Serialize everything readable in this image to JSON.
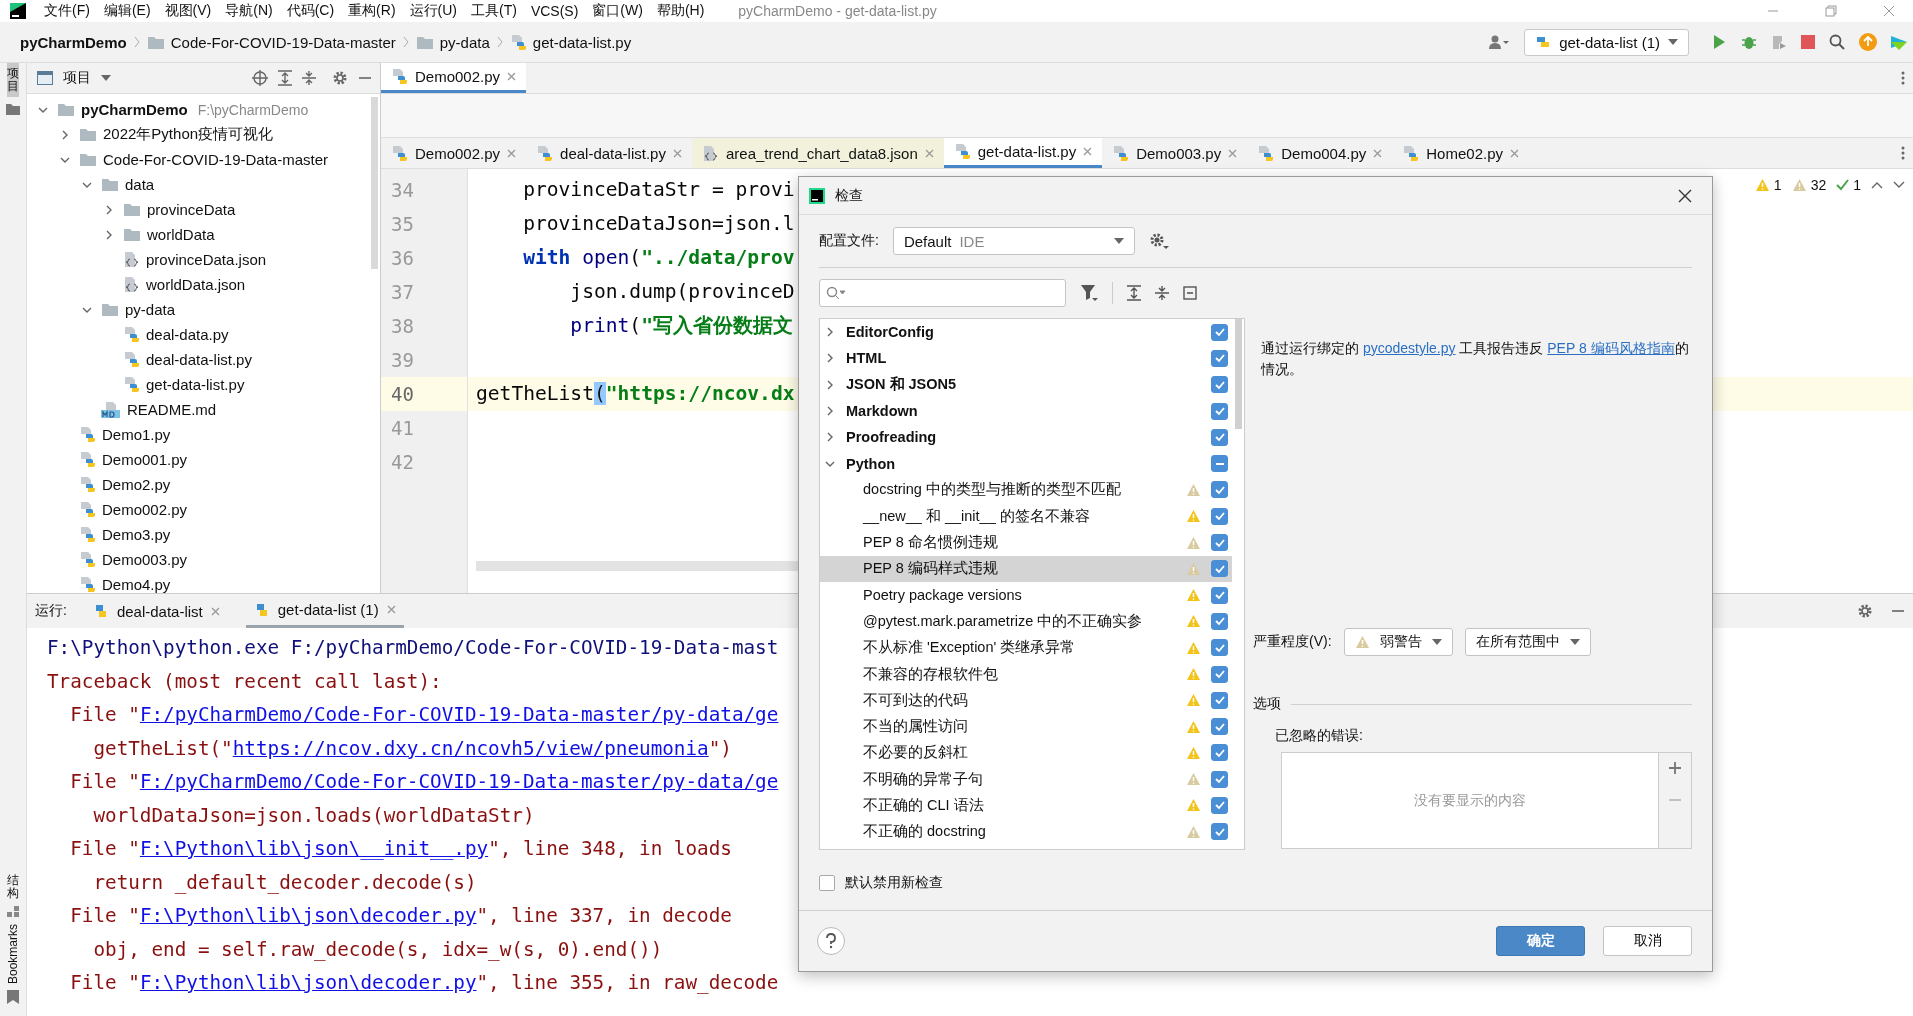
{
  "menu_bar": {
    "items": [
      "文件(F)",
      "编辑(E)",
      "视图(V)",
      "导航(N)",
      "代码(C)",
      "重构(R)",
      "运行(U)",
      "工具(T)",
      "VCS(S)",
      "窗口(W)",
      "帮助(H)"
    ],
    "title": "pyCharmDemo - get-data-list.py"
  },
  "breadcrumb": [
    {
      "label": "pyCharmDemo",
      "kind": "project"
    },
    {
      "label": "Code-For-COVID-19-Data-master",
      "kind": "folder"
    },
    {
      "label": "py-data",
      "kind": "folder"
    },
    {
      "label": "get-data-list.py",
      "kind": "python"
    }
  ],
  "run_config": {
    "label": "get-data-list (1)"
  },
  "tool_stripe": {
    "top": {
      "label": "项目",
      "selected": true
    },
    "bottom": [
      {
        "label": "结构",
        "kind": "cjk"
      },
      {
        "label": "Bookmarks",
        "kind": "latin"
      }
    ]
  },
  "project_panel": {
    "title": "项目",
    "tree": [
      {
        "name": "pyCharmDemo",
        "path": "F:\\pyCharmDemo",
        "kind": "folder",
        "expanded": true,
        "children": [
          {
            "name": "2022年Python疫情可视化",
            "kind": "folder",
            "expanded": false
          },
          {
            "name": "Code-For-COVID-19-Data-master",
            "kind": "folder",
            "expanded": true,
            "children": [
              {
                "name": "data",
                "kind": "folder",
                "expanded": true,
                "children": [
                  {
                    "name": "provinceData",
                    "kind": "folder",
                    "expanded": false
                  },
                  {
                    "name": "worldData",
                    "kind": "folder",
                    "expanded": false
                  },
                  {
                    "name": "provinceData.json",
                    "kind": "json"
                  },
                  {
                    "name": "worldData.json",
                    "kind": "json"
                  }
                ]
              },
              {
                "name": "py-data",
                "kind": "folder",
                "expanded": true,
                "children": [
                  {
                    "name": "deal-data.py",
                    "kind": "python"
                  },
                  {
                    "name": "deal-data-list.py",
                    "kind": "python"
                  },
                  {
                    "name": "get-data-list.py",
                    "kind": "python"
                  }
                ]
              },
              {
                "name": "README.md",
                "kind": "md"
              }
            ]
          },
          {
            "name": "Demo1.py",
            "kind": "python"
          },
          {
            "name": "Demo001.py",
            "kind": "python"
          },
          {
            "name": "Demo2.py",
            "kind": "python"
          },
          {
            "name": "Demo002.py",
            "kind": "python"
          },
          {
            "name": "Demo3.py",
            "kind": "python"
          },
          {
            "name": "Demo003.py",
            "kind": "python"
          },
          {
            "name": "Demo4.py",
            "kind": "python"
          }
        ]
      }
    ]
  },
  "editor": {
    "top_tab": {
      "label": "Demo002.py",
      "kind": "python"
    },
    "tabs": [
      {
        "label": "Demo002.py",
        "kind": "python",
        "selected": false
      },
      {
        "label": "deal-data-list.py",
        "kind": "python",
        "selected": false
      },
      {
        "label": "area_trend_chart_data8.json",
        "kind": "json",
        "selected": false
      },
      {
        "label": "get-data-list.py",
        "kind": "python",
        "selected": true
      },
      {
        "label": "Demo003.py",
        "kind": "python",
        "selected": false
      },
      {
        "label": "Demo004.py",
        "kind": "python",
        "selected": false
      },
      {
        "label": "Home02.py",
        "kind": "python",
        "selected": false
      }
    ],
    "inspection_counts": [
      {
        "kind": "warning",
        "count": "1"
      },
      {
        "kind": "weak_warning",
        "count": "32"
      },
      {
        "kind": "ok",
        "count": "1"
      }
    ],
    "lines": [
      {
        "number": "34",
        "current": false,
        "segments": [
          {
            "kind": "plain",
            "text": "    provinceDataStr = provi"
          }
        ]
      },
      {
        "number": "35",
        "current": false,
        "segments": [
          {
            "kind": "plain",
            "text": "    provinceDataJson=json.l"
          }
        ]
      },
      {
        "number": "36",
        "current": false,
        "segments": [
          {
            "kind": "keyword",
            "text": "    with"
          },
          {
            "kind": "builtin",
            "text": " open"
          },
          {
            "kind": "plain",
            "text": "("
          },
          {
            "kind": "string",
            "text": "\"../data/prov"
          }
        ]
      },
      {
        "number": "37",
        "current": false,
        "segments": [
          {
            "kind": "plain",
            "text": "        json.dump(provinceD"
          }
        ]
      },
      {
        "number": "38",
        "current": false,
        "segments": [
          {
            "kind": "builtin",
            "text": "        print"
          },
          {
            "kind": "plain",
            "text": "("
          },
          {
            "kind": "string",
            "text": "\"写入省份数据文"
          }
        ]
      },
      {
        "number": "39",
        "current": false
      },
      {
        "number": "40",
        "current": true,
        "segments": [
          {
            "kind": "plain",
            "text": "getTheList"
          },
          {
            "kind": "match",
            "text": "("
          },
          {
            "kind": "string",
            "text": "\"https://ncov.dx"
          }
        ]
      },
      {
        "number": "41",
        "current": false
      },
      {
        "number": "42",
        "current": false
      }
    ]
  },
  "run_panel": {
    "label": "运行:",
    "tabs": [
      {
        "label": "deal-data-list",
        "selected": false
      },
      {
        "label": "get-data-list (1)",
        "selected": true
      }
    ],
    "lines": [
      {
        "segments": [
          {
            "kind": "command",
            "text": "F:\\Python\\python.exe F:/pyCharmDemo/Code-For-COVID-19-Data-mast"
          }
        ]
      },
      {
        "segments": [
          {
            "kind": "error",
            "text": "Traceback (most recent call last):"
          }
        ]
      },
      {
        "segments": [
          {
            "kind": "error",
            "text": "  File \""
          },
          {
            "kind": "link",
            "text": "F:/pyCharmDemo/Code-For-COVID-19-Data-master/py-data/ge"
          }
        ]
      },
      {
        "segments": [
          {
            "kind": "error",
            "text": "    getTheList(\""
          },
          {
            "kind": "link",
            "text": "https://ncov.dxy.cn/ncovh5/view/pneumonia"
          },
          {
            "kind": "error",
            "text": "\")"
          }
        ]
      },
      {
        "segments": [
          {
            "kind": "error",
            "text": "  File \""
          },
          {
            "kind": "link",
            "text": "F:/pyCharmDemo/Code-For-COVID-19-Data-master/py-data/ge"
          }
        ]
      },
      {
        "segments": [
          {
            "kind": "error",
            "text": "    worldDataJson=json.loads(worldDataStr)"
          }
        ]
      },
      {
        "segments": [
          {
            "kind": "error",
            "text": "  File \""
          },
          {
            "kind": "link",
            "text": "F:\\Python\\lib\\json\\__init__.py"
          },
          {
            "kind": "error",
            "text": "\", line 348, in loads"
          }
        ]
      },
      {
        "segments": [
          {
            "kind": "error",
            "text": "    return _default_decoder.decode(s)"
          }
        ]
      },
      {
        "segments": [
          {
            "kind": "error",
            "text": "  File \""
          },
          {
            "kind": "link",
            "text": "F:\\Python\\lib\\json\\decoder.py"
          },
          {
            "kind": "error",
            "text": "\", line 337, in decode"
          }
        ]
      },
      {
        "segments": [
          {
            "kind": "error",
            "text": "    obj, end = self.raw_decode(s, idx=_w(s, 0).end())"
          }
        ]
      },
      {
        "segments": [
          {
            "kind": "error",
            "text": "  File \""
          },
          {
            "kind": "link",
            "text": "F:\\Python\\lib\\json\\decoder.py"
          },
          {
            "kind": "error",
            "text": "\", line 355, in raw_decode"
          }
        ]
      }
    ]
  },
  "dialog": {
    "title": "检查",
    "profile": {
      "label": "配置文件:",
      "value": "Default",
      "scope": "IDE"
    },
    "tree": [
      {
        "name": "EditorConfig",
        "expanded": false,
        "checked": true,
        "indeterminate": false
      },
      {
        "name": "HTML",
        "expanded": false,
        "checked": true,
        "indeterminate": false
      },
      {
        "name": "JSON 和 JSON5",
        "expanded": false,
        "checked": true,
        "indeterminate": false
      },
      {
        "name": "Markdown",
        "expanded": false,
        "checked": true,
        "indeterminate": false
      },
      {
        "name": "Proofreading",
        "expanded": false,
        "checked": true,
        "indeterminate": false
      },
      {
        "name": "Python",
        "expanded": true,
        "checked": true,
        "indeterminate": true,
        "children": [
          {
            "name": "docstring 中的类型与推断的类型不匹配",
            "kind": "weak_warning",
            "checked": true,
            "selected": false
          },
          {
            "name": "__new__ 和 __init__ 的签名不兼容",
            "kind": "warning",
            "checked": true,
            "selected": false
          },
          {
            "name": "PEP 8 命名惯例违规",
            "kind": "weak_warning",
            "checked": true,
            "selected": false
          },
          {
            "name": "PEP 8 编码样式违规",
            "kind": "weak_warning",
            "checked": true,
            "selected": true
          },
          {
            "name": "Poetry package versions",
            "kind": "warning",
            "checked": true,
            "selected": false
          },
          {
            "name": "@pytest.mark.parametrize 中的不正确实参",
            "kind": "warning",
            "checked": true,
            "selected": false
          },
          {
            "name": "不从标准 'Exception' 类继承异常",
            "kind": "warning",
            "checked": true,
            "selected": false
          },
          {
            "name": "不兼容的存根软件包",
            "kind": "warning",
            "checked": true,
            "selected": false
          },
          {
            "name": "不可到达的代码",
            "kind": "warning",
            "checked": true,
            "selected": false
          },
          {
            "name": "不当的属性访问",
            "kind": "warning",
            "checked": true,
            "selected": false
          },
          {
            "name": "不必要的反斜杠",
            "kind": "warning",
            "checked": true,
            "selected": false
          },
          {
            "name": "不明确的异常子句",
            "kind": "weak_warning",
            "checked": true,
            "selected": false
          },
          {
            "name": "不正确的 CLI 语法",
            "kind": "warning",
            "checked": true,
            "selected": false
          },
          {
            "name": "不正确的 docstring",
            "kind": "weak_warning",
            "checked": true,
            "selected": false
          }
        ]
      }
    ],
    "disable_new": {
      "label": "默认禁用新检查",
      "checked": false
    },
    "description": [
      {
        "text": "通过运行绑定的 ",
        "link": false
      },
      {
        "text": "pycodestyle.py",
        "link": true
      },
      {
        "text": " 工具报告违反 ",
        "link": false
      },
      {
        "text": "PEP 8 编码风格指南",
        "link": true
      },
      {
        "text": "的情况。",
        "link": false
      }
    ],
    "severity": {
      "label": "严重程度(V):",
      "value": "弱警告",
      "kind": "weak_warning",
      "scope": "在所有范围中"
    },
    "options": {
      "title": "选项",
      "ignored_label": "已忽略的错误:",
      "empty_text": "没有要显示的内容"
    },
    "buttons": [
      {
        "label": "确定",
        "kind": "primary"
      },
      {
        "label": "取消",
        "kind": "secondary"
      }
    ]
  }
}
